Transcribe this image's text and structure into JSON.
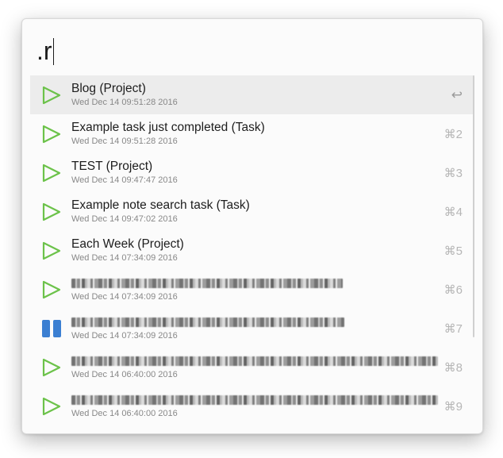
{
  "search": {
    "query": ".r"
  },
  "colors": {
    "play_icon": "#6cc24a",
    "pause_icon": "#3b7fd2",
    "selected_row": "#ececec"
  },
  "results": [
    {
      "icon": "play-icon",
      "title": "Blog (Project)",
      "subtitle": "Wed Dec 14 09:51:28 2016",
      "shortcut": "↩",
      "selected": true,
      "redacted": false
    },
    {
      "icon": "play-icon",
      "title": "Example task just completed (Task)",
      "subtitle": "Wed Dec 14 09:51:28 2016",
      "shortcut": "⌘2",
      "redacted": false
    },
    {
      "icon": "play-icon",
      "title": "TEST (Project)",
      "subtitle": "Wed Dec 14 09:47:47 2016",
      "shortcut": "⌘3",
      "redacted": false
    },
    {
      "icon": "play-icon",
      "title": "Example note search task (Task)",
      "subtitle": "Wed Dec 14 09:47:02 2016",
      "shortcut": "⌘4",
      "redacted": false
    },
    {
      "icon": "play-icon",
      "title": "Each Week (Project)",
      "subtitle": "Wed Dec 14 07:34:09 2016",
      "shortcut": "⌘5",
      "redacted": false
    },
    {
      "icon": "play-icon",
      "title": "",
      "subtitle": "Wed Dec 14 07:34:09 2016",
      "shortcut": "⌘6",
      "redacted": true
    },
    {
      "icon": "pause-icon",
      "title": "",
      "subtitle": "Wed Dec 14 07:34:09 2016",
      "shortcut": "⌘7",
      "redacted": true
    },
    {
      "icon": "play-icon",
      "title": "",
      "subtitle": "Wed Dec 14 06:40:00 2016",
      "shortcut": "⌘8",
      "redacted": true
    },
    {
      "icon": "play-icon",
      "title": "",
      "subtitle": "Wed Dec 14 06:40:00 2016",
      "shortcut": "⌘9",
      "redacted": true
    }
  ]
}
